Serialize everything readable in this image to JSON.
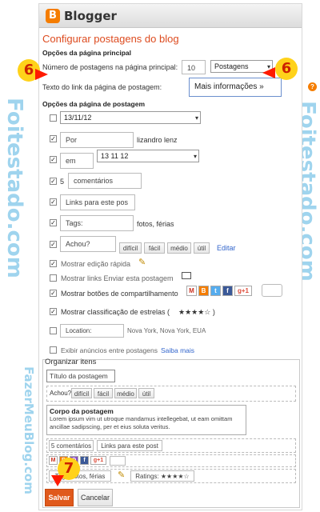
{
  "watermark": {
    "left": "Foitestado.com",
    "right": "Foitestado.com",
    "bottom": "FazerMeuBlog.com"
  },
  "brand": {
    "logo_letter": "B",
    "name": "Blogger",
    "accent": "#f57d00"
  },
  "page_title": "Configurar postagens do blog",
  "main": {
    "section_title": "Opções da página principal",
    "posts_count_label": "Número de postagens na página principal:",
    "posts_count_value": "10",
    "posts_unit_value": "Postagens",
    "link_text_label": "Texto do link da página de postagem:",
    "link_text_value": "Mais informações  »",
    "help_icon": "?"
  },
  "post_options": {
    "section_title": "Opções da página de postagem",
    "date_value": "13/11/12",
    "by_value": "Por",
    "author": "lizandro lenz",
    "at_value": "em",
    "time_value": "13 11 12",
    "comments_count": "5",
    "comments_value": "comentários",
    "links_value": "Links para este pos",
    "tags_value": "Tags:",
    "tags_sample": "fotos, férias",
    "reactions_value": "Achou?",
    "reactions": [
      "difícil",
      "fácil",
      "médio",
      "útil"
    ],
    "edit_link": "Editar",
    "quick_edit": "Mostrar edição rápida",
    "email_links": "Mostrar links Enviar esta postagem",
    "share_buttons": "Mostrar botões de compartilhamento",
    "share_icons": [
      "M",
      "B",
      "t",
      "f",
      "g+1"
    ],
    "star_ratings": "Mostrar classificação de estrelas (",
    "stars": "★★★★☆ )",
    "location_value": "Location:",
    "location_sample": "Nova York, Nova York, EUA",
    "ads_label": "Exibir anúncios entre postagens",
    "ads_link": "Saiba mais"
  },
  "organize": {
    "title": "Organizar itens",
    "post_title": "Título da postagem",
    "reactions_label": "Achou?",
    "reactions": [
      "difícil",
      "fácil",
      "médio",
      "útil"
    ],
    "body_title": "Corpo da postagem",
    "body_text": "Lorem ipsum vim ut utroque mandamus intellegebat, ut eam omittam ancillae sadipscing, per et eius soluta veritus.",
    "comments": "5 comentários",
    "links": "Links para este post",
    "share_icons": [
      "M",
      "B",
      "O",
      "f",
      "g+1"
    ],
    "tags": "Tags: fotos, férias",
    "ratings": "Ratings: ★★★★☆"
  },
  "annotations": [
    "6",
    "6",
    "7"
  ],
  "buttons": {
    "save": "Salvar",
    "cancel": "Cancelar"
  }
}
